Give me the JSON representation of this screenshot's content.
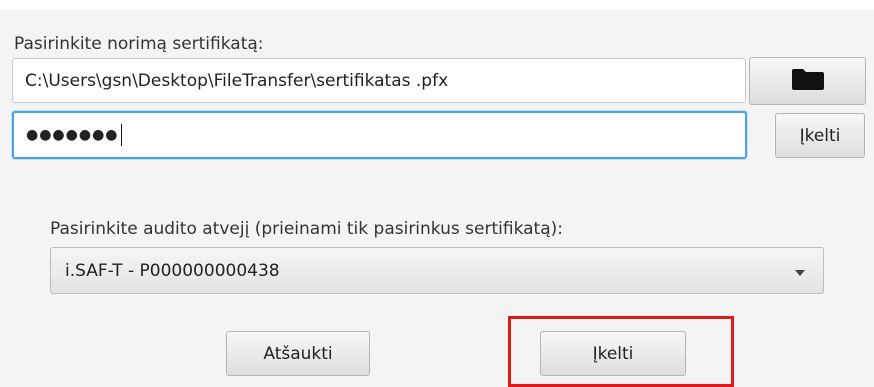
{
  "certificate_section": {
    "label": "Pasirinkite norimą  sertifikatą:",
    "path_value": "C:\\Users\\gsn\\Desktop\\FileTransfer\\sertifikatas .pfx",
    "password_mask": "●●●●●●●",
    "browse_icon": "folder-icon",
    "load_label": "Įkelti"
  },
  "audit_section": {
    "label": "Pasirinkite audito atvejį (prieinami tik pasirinkus sertifikatą):",
    "selected": "i.SAF-T - P000000000438"
  },
  "footer": {
    "cancel_label": "Atšaukti",
    "upload_label": "Įkelti",
    "highlight_color": "#e0191c"
  }
}
